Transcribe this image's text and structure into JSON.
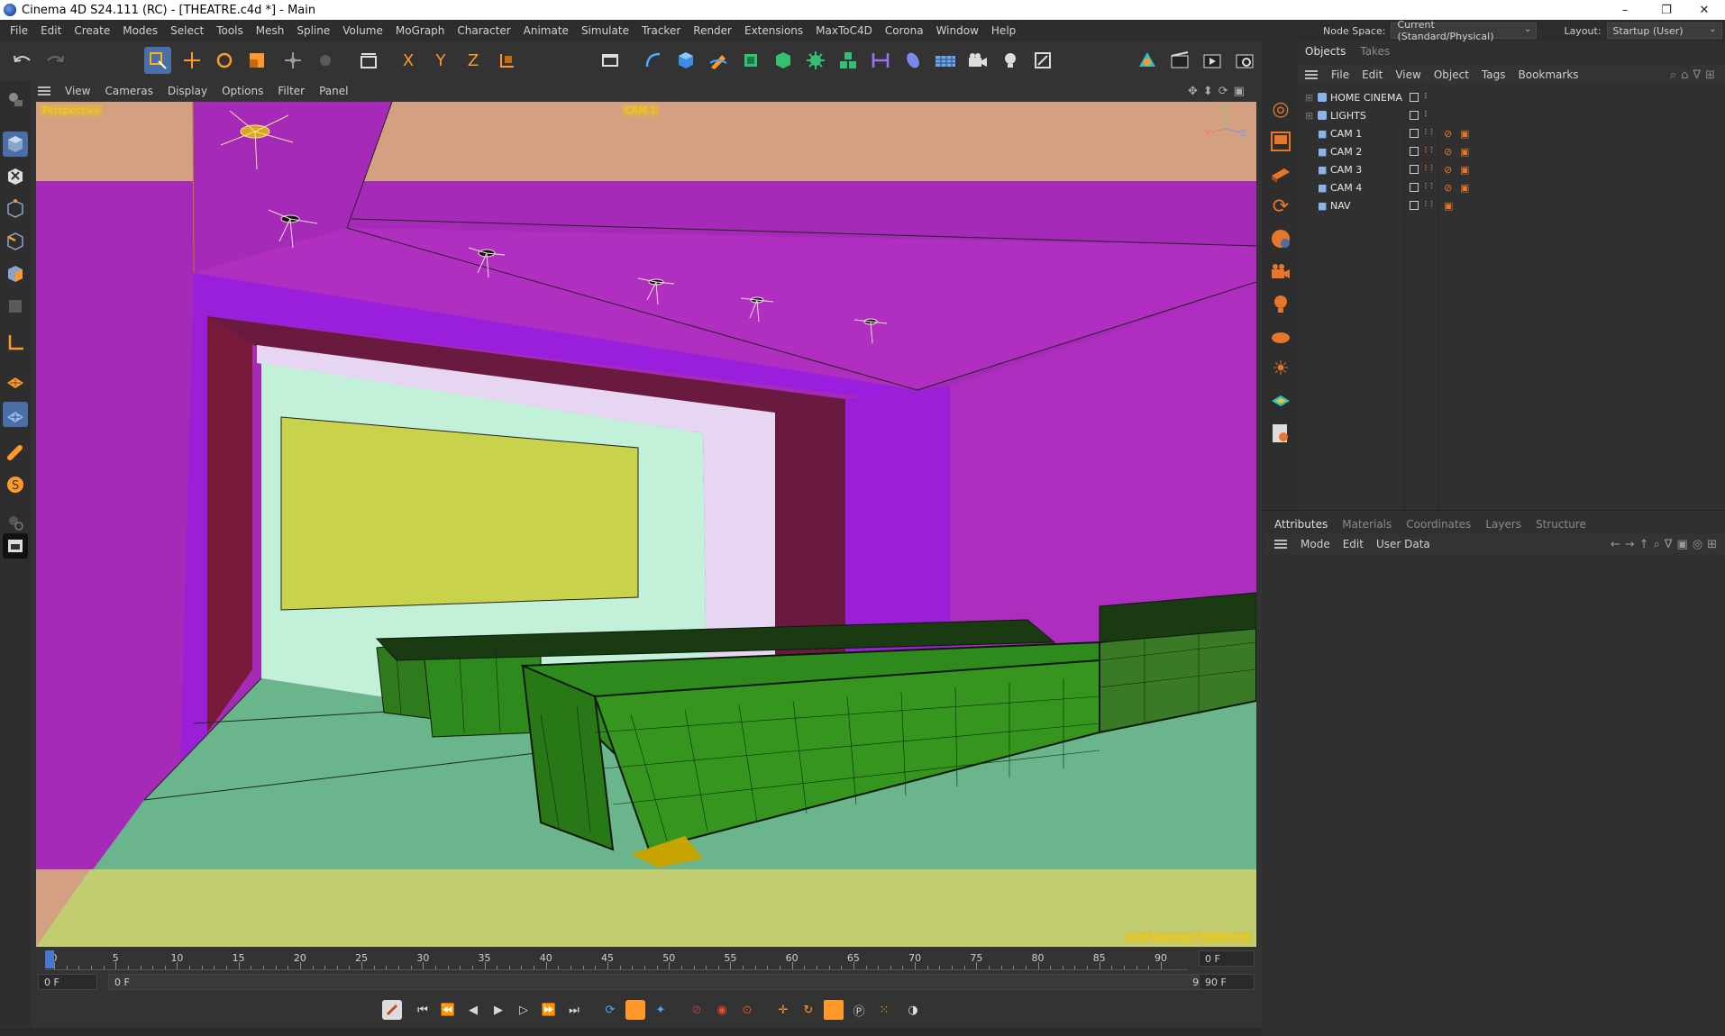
{
  "window": {
    "title": "Cinema 4D S24.111 (RC) - [THEATRE.c4d *] - Main",
    "minimize": "–",
    "maximize": "❐",
    "close": "✕"
  },
  "menubar": {
    "items": [
      "File",
      "Edit",
      "Create",
      "Modes",
      "Select",
      "Tools",
      "Mesh",
      "Spline",
      "Volume",
      "MoGraph",
      "Character",
      "Animate",
      "Simulate",
      "Tracker",
      "Render",
      "Extensions",
      "MaxToC4D",
      "Corona",
      "Window",
      "Help"
    ],
    "node_space_label": "Node Space:",
    "node_space_value": "Current (Standard/Physical)",
    "layout_label": "Layout:",
    "layout_value": "Startup (User)"
  },
  "toolbar": {
    "axis_x": "X",
    "axis_y": "Y",
    "axis_z": "Z"
  },
  "viewport": {
    "menu": [
      "View",
      "Cameras",
      "Display",
      "Options",
      "Filter",
      "Panel"
    ],
    "view_name": "Perspective",
    "camera_name": "CAM 1",
    "grid_spacing": "Grid Spacing : 50000 cm",
    "axis_x": "X",
    "axis_y": "Y",
    "axis_z": "Z"
  },
  "timeline": {
    "ticks": [
      "0",
      "5",
      "10",
      "15",
      "20",
      "25",
      "30",
      "35",
      "40",
      "45",
      "50",
      "55",
      "60",
      "65",
      "70",
      "75",
      "80",
      "85",
      "90"
    ],
    "current_frame": "0 F",
    "start_frame": "0 F",
    "range_start": "0 F",
    "range_end": "90 F",
    "end_frame": "90 F"
  },
  "objects_panel": {
    "tabs": [
      "Objects",
      "Takes"
    ],
    "menu": [
      "File",
      "Edit",
      "View",
      "Object",
      "Tags",
      "Bookmarks"
    ],
    "objects": [
      {
        "name": "HOME CINEMA",
        "type": "null"
      },
      {
        "name": "LIGHTS",
        "type": "null"
      },
      {
        "name": "CAM 1",
        "type": "camera"
      },
      {
        "name": "CAM 2",
        "type": "camera"
      },
      {
        "name": "CAM 3",
        "type": "camera"
      },
      {
        "name": "CAM 4",
        "type": "camera"
      },
      {
        "name": "NAV",
        "type": "camera"
      }
    ]
  },
  "attributes_panel": {
    "tabs": [
      "Attributes",
      "Materials",
      "Coordinates",
      "Layers",
      "Structure"
    ],
    "menu": [
      "Mode",
      "Edit",
      "User Data"
    ]
  },
  "colors": {
    "accent": "#4a6ea8",
    "orange_icon": "#e8762a",
    "wall_magenta": "#a52bb8",
    "screen_yellow": "#c8d24a",
    "sofa_green": "#2f8a1e",
    "floor_green": "#6ab58c"
  }
}
